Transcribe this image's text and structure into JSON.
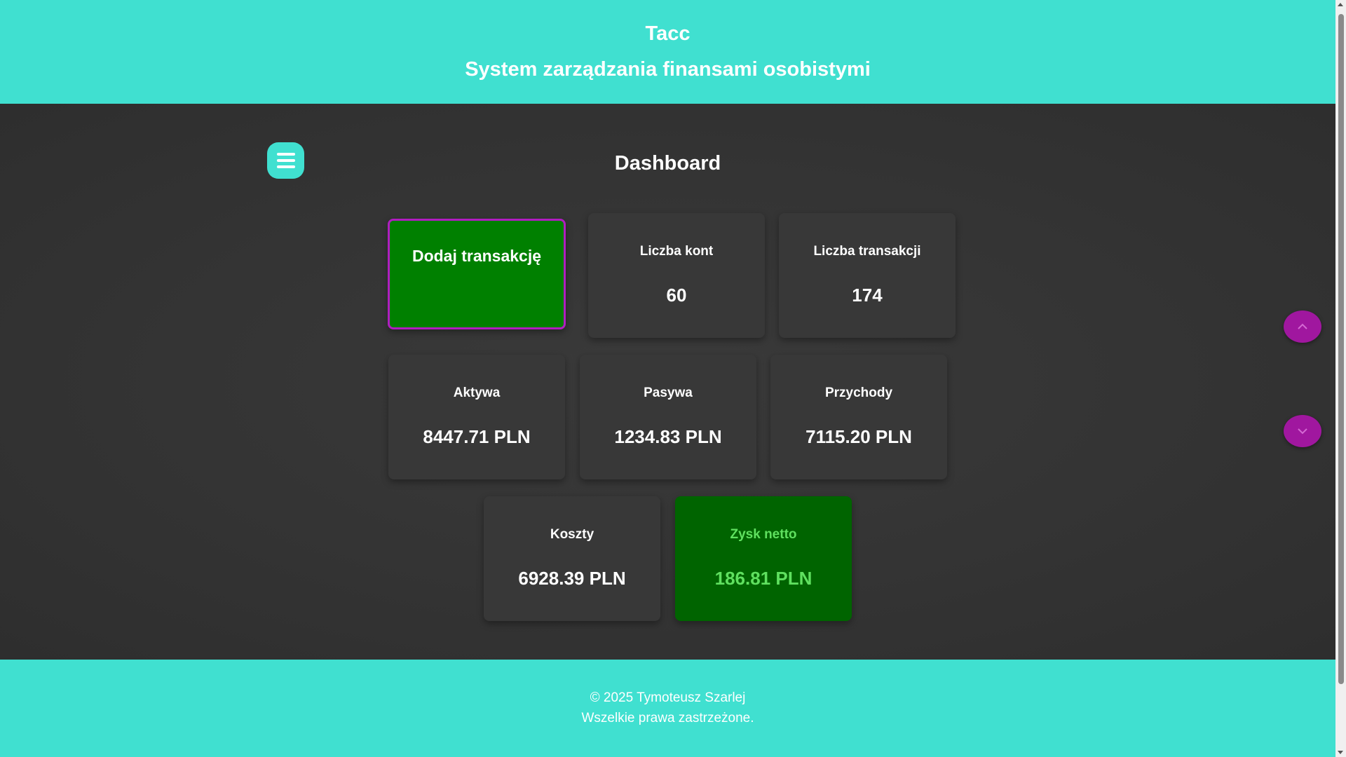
{
  "header": {
    "title": "Tacc",
    "subtitle": "System zarządzania finansami osobistymi"
  },
  "dashboard": {
    "title": "Dashboard",
    "menu_icon": "hamburger-icon",
    "add_transaction_label": "Dodaj transakcję",
    "cards": {
      "accounts": {
        "label": "Liczba kont",
        "value": "60"
      },
      "transactions": {
        "label": "Liczba transakcji",
        "value": "174"
      },
      "assets": {
        "label": "Aktywa",
        "value": "8447.71 PLN"
      },
      "liabilities": {
        "label": "Pasywa",
        "value": "1234.83 PLN"
      },
      "income": {
        "label": "Przychody",
        "value": "7115.20 PLN"
      },
      "costs": {
        "label": "Koszty",
        "value": "6928.39 PLN"
      },
      "net_profit": {
        "label": "Zysk netto",
        "value": "186.81 PLN"
      }
    }
  },
  "scroll_buttons": {
    "up_icon": "chevron-up-icon",
    "down_icon": "chevron-down-icon"
  },
  "footer": {
    "copyright": "© 2025 Tymoteusz Szarlej",
    "rights": "Wszelkie prawa zastrzeżone."
  },
  "colors": {
    "accent": "#40e0d0",
    "background": "#333333",
    "card": "#383838",
    "add_button": "#008000",
    "add_button_border": "#b01ec0",
    "profit_card": "#006400",
    "profit_text": "#5fe05f",
    "scroll_button": "#a0179f"
  }
}
